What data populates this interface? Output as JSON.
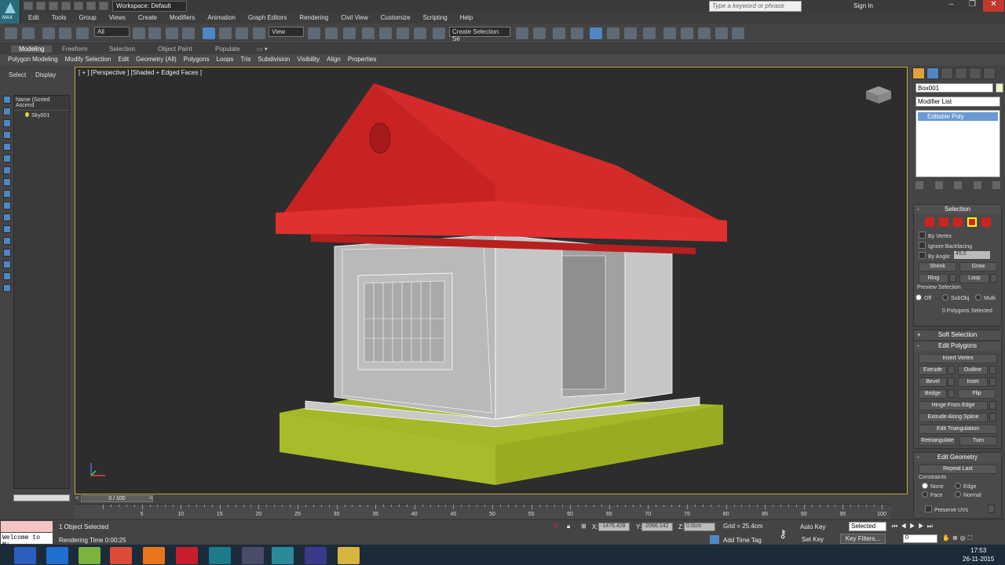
{
  "title_bar": {
    "app_logo": "MAX",
    "workspace": "Workspace: Default",
    "search_placeholder": "Type a keyword or phrase",
    "sign_in": "Sign In"
  },
  "menu": [
    "Edit",
    "Tools",
    "Group",
    "Views",
    "Create",
    "Modifiers",
    "Animation",
    "Graph Editors",
    "Rendering",
    "Civil View",
    "Customize",
    "Scripting",
    "Help"
  ],
  "toolbar": {
    "selection_filter": "All",
    "ref_coord": "View",
    "named_selection": "Create Selection Se"
  },
  "ribbon": {
    "tabs": [
      "Modeling",
      "Freeform",
      "Selection",
      "Object Paint",
      "Populate"
    ],
    "items": [
      "Polygon Modeling",
      "Modify Selection",
      "Edit",
      "Geometry (All)",
      "Polygons",
      "Loops",
      "Tris",
      "Subdivision",
      "Visibility",
      "Align",
      "Properties"
    ]
  },
  "scene_explorer": {
    "tab_select": "Select",
    "tab_display": "Display",
    "header": "Name (Sorted Ascend",
    "items": [
      "Sky001"
    ]
  },
  "viewport": {
    "label": "[ + ] [Perspective ] [Shaded + Edged Faces ]"
  },
  "timeline": {
    "slider": "0 / 100",
    "ticks": [
      "5",
      "10",
      "15",
      "20",
      "25",
      "30",
      "35",
      "40",
      "45",
      "50",
      "55",
      "60",
      "65",
      "70",
      "75",
      "80",
      "85",
      "90",
      "95",
      "100"
    ]
  },
  "status": {
    "listener": "Welcome to M:",
    "selected": "1 Object Selected",
    "render_time": "Rendering Time  0:00:25",
    "x_label": "X:",
    "x": "-1476.428",
    "y_label": "Y:",
    "y": "-2066.142",
    "z_label": "Z:",
    "z": "0.0cm",
    "grid": "Grid = 25.4cm",
    "add_time_tag": "Add Time Tag",
    "auto_key": "Auto Key",
    "set_key": "Set Key",
    "auto_key_mode": "Selected",
    "key_filters": "Key Filters...",
    "frame": "0"
  },
  "command_panel": {
    "object_name": "Box001",
    "modifier_list": "Modifier List",
    "stack_item": "Editable Poly",
    "selection": {
      "header": "Selection",
      "by_vertex": "By Vertex",
      "ignore_backfacing": "Ignore Backfacing",
      "by_angle": "By Angle:",
      "angle_value": "45.0",
      "shrink": "Shrink",
      "grow": "Grow",
      "ring": "Ring",
      "loop": "Loop",
      "preview_label": "Preview Selection",
      "preview_off": "Off",
      "preview_subobj": "SubObj",
      "preview_multi": "Multi",
      "status": "0 Polygons Selected"
    },
    "soft_selection": "Soft Selection",
    "edit_polygons": {
      "header": "Edit Polygons",
      "insert_vertex": "Insert Vertex",
      "extrude": "Extrude",
      "outline": "Outline",
      "bevel": "Bevel",
      "inset": "Inset",
      "bridge": "Bridge",
      "flip": "Flip",
      "hinge": "Hinge From Edge",
      "extrude_spline": "Extrude Along Spline",
      "edit_triangulation": "Edit Triangulation",
      "retriangulate": "Retriangulate",
      "turn": "Turn"
    },
    "edit_geometry": {
      "header": "Edit Geometry",
      "repeat_last": "Repeat Last",
      "constraints": "Constraints",
      "none": "None",
      "edge": "Edge",
      "face": "Face",
      "normal": "Normal",
      "preserve_uvs": "Preserve UVs"
    }
  },
  "taskbar": {
    "time": "17:53",
    "date": "26-11-2015"
  },
  "colors": {
    "roof": "#d42a2a",
    "walls": "#c8c8c8",
    "base": "#a8bb2a",
    "viewport_bg": "#2d2d2d",
    "active_border": "#c6a53d"
  }
}
